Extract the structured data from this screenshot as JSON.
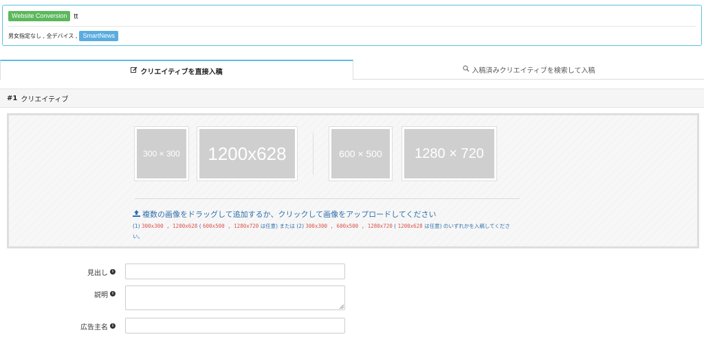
{
  "campaign": {
    "objective_badge": "Website Conversion",
    "name": "tt",
    "targeting_text": "男女指定なし , 全デバイス ,",
    "platform_badge": "SmartNews"
  },
  "tabs": [
    {
      "label": "クリエイティブを直接入稿",
      "icon": "edit-icon",
      "active": true
    },
    {
      "label": "入稿済みクリエイティブを検索して入稿",
      "icon": "search-icon",
      "active": false
    }
  ],
  "section": {
    "number": "#1",
    "title": "クリエイティブ"
  },
  "dropzone": {
    "placeholders": [
      "300 × 300",
      "1200x628",
      "600 × 500",
      "1280 × 720"
    ],
    "upload_text": "複数の画像をドラッグして追加するか、クリックして画像をアップロードしてください",
    "rule": {
      "p1": "(1)",
      "s1": "300x300 , 1200x628",
      "p2": "(",
      "s2": "600x500 , 1280x720",
      "p3": "は任意) または (2)",
      "s3": "300x300 , 600x500 , 1280x720",
      "p4": "(",
      "s4": "1200x628",
      "p5": "は任意) のいずれかを入稿してください。"
    }
  },
  "form": {
    "headline_label": "見出し",
    "description_label": "説明",
    "advertiser_label": "広告主名"
  },
  "colors": {
    "accent": "#5bc0de",
    "badge_green": "#5cb85c",
    "badge_blue": "#5bacde",
    "link_blue": "#2f6fad",
    "required_red": "#d9534f"
  }
}
